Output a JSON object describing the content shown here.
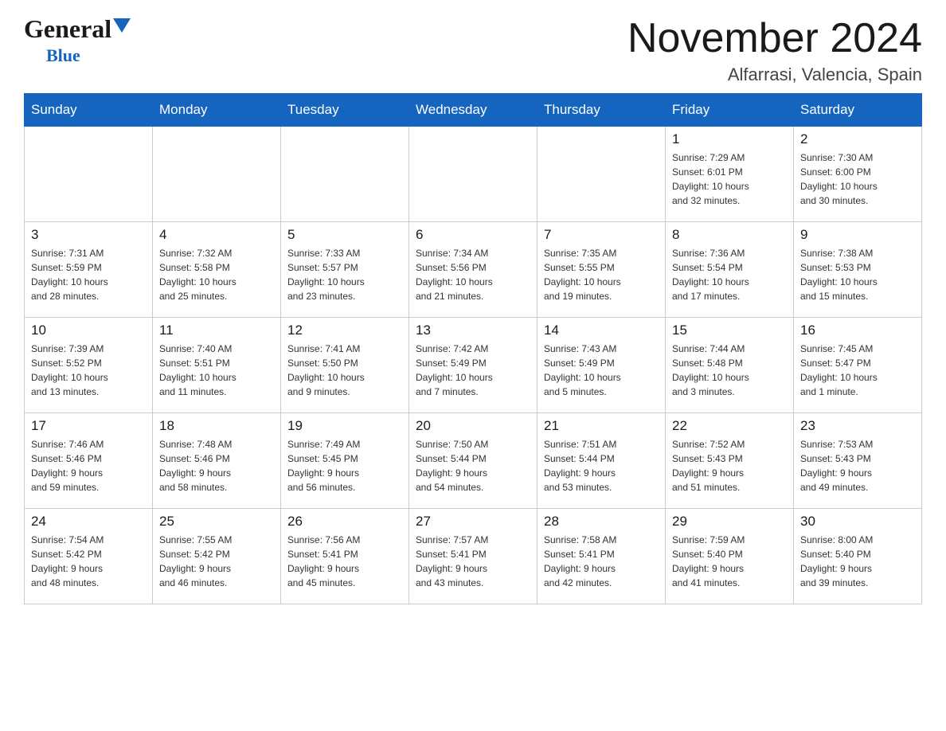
{
  "header": {
    "logo_general": "General",
    "logo_blue": "Blue",
    "month_title": "November 2024",
    "location": "Alfarrasi, Valencia, Spain"
  },
  "days_of_week": [
    "Sunday",
    "Monday",
    "Tuesday",
    "Wednesday",
    "Thursday",
    "Friday",
    "Saturday"
  ],
  "weeks": [
    [
      {
        "day": "",
        "info": ""
      },
      {
        "day": "",
        "info": ""
      },
      {
        "day": "",
        "info": ""
      },
      {
        "day": "",
        "info": ""
      },
      {
        "day": "",
        "info": ""
      },
      {
        "day": "1",
        "info": "Sunrise: 7:29 AM\nSunset: 6:01 PM\nDaylight: 10 hours\nand 32 minutes."
      },
      {
        "day": "2",
        "info": "Sunrise: 7:30 AM\nSunset: 6:00 PM\nDaylight: 10 hours\nand 30 minutes."
      }
    ],
    [
      {
        "day": "3",
        "info": "Sunrise: 7:31 AM\nSunset: 5:59 PM\nDaylight: 10 hours\nand 28 minutes."
      },
      {
        "day": "4",
        "info": "Sunrise: 7:32 AM\nSunset: 5:58 PM\nDaylight: 10 hours\nand 25 minutes."
      },
      {
        "day": "5",
        "info": "Sunrise: 7:33 AM\nSunset: 5:57 PM\nDaylight: 10 hours\nand 23 minutes."
      },
      {
        "day": "6",
        "info": "Sunrise: 7:34 AM\nSunset: 5:56 PM\nDaylight: 10 hours\nand 21 minutes."
      },
      {
        "day": "7",
        "info": "Sunrise: 7:35 AM\nSunset: 5:55 PM\nDaylight: 10 hours\nand 19 minutes."
      },
      {
        "day": "8",
        "info": "Sunrise: 7:36 AM\nSunset: 5:54 PM\nDaylight: 10 hours\nand 17 minutes."
      },
      {
        "day": "9",
        "info": "Sunrise: 7:38 AM\nSunset: 5:53 PM\nDaylight: 10 hours\nand 15 minutes."
      }
    ],
    [
      {
        "day": "10",
        "info": "Sunrise: 7:39 AM\nSunset: 5:52 PM\nDaylight: 10 hours\nand 13 minutes."
      },
      {
        "day": "11",
        "info": "Sunrise: 7:40 AM\nSunset: 5:51 PM\nDaylight: 10 hours\nand 11 minutes."
      },
      {
        "day": "12",
        "info": "Sunrise: 7:41 AM\nSunset: 5:50 PM\nDaylight: 10 hours\nand 9 minutes."
      },
      {
        "day": "13",
        "info": "Sunrise: 7:42 AM\nSunset: 5:49 PM\nDaylight: 10 hours\nand 7 minutes."
      },
      {
        "day": "14",
        "info": "Sunrise: 7:43 AM\nSunset: 5:49 PM\nDaylight: 10 hours\nand 5 minutes."
      },
      {
        "day": "15",
        "info": "Sunrise: 7:44 AM\nSunset: 5:48 PM\nDaylight: 10 hours\nand 3 minutes."
      },
      {
        "day": "16",
        "info": "Sunrise: 7:45 AM\nSunset: 5:47 PM\nDaylight: 10 hours\nand 1 minute."
      }
    ],
    [
      {
        "day": "17",
        "info": "Sunrise: 7:46 AM\nSunset: 5:46 PM\nDaylight: 9 hours\nand 59 minutes."
      },
      {
        "day": "18",
        "info": "Sunrise: 7:48 AM\nSunset: 5:46 PM\nDaylight: 9 hours\nand 58 minutes."
      },
      {
        "day": "19",
        "info": "Sunrise: 7:49 AM\nSunset: 5:45 PM\nDaylight: 9 hours\nand 56 minutes."
      },
      {
        "day": "20",
        "info": "Sunrise: 7:50 AM\nSunset: 5:44 PM\nDaylight: 9 hours\nand 54 minutes."
      },
      {
        "day": "21",
        "info": "Sunrise: 7:51 AM\nSunset: 5:44 PM\nDaylight: 9 hours\nand 53 minutes."
      },
      {
        "day": "22",
        "info": "Sunrise: 7:52 AM\nSunset: 5:43 PM\nDaylight: 9 hours\nand 51 minutes."
      },
      {
        "day": "23",
        "info": "Sunrise: 7:53 AM\nSunset: 5:43 PM\nDaylight: 9 hours\nand 49 minutes."
      }
    ],
    [
      {
        "day": "24",
        "info": "Sunrise: 7:54 AM\nSunset: 5:42 PM\nDaylight: 9 hours\nand 48 minutes."
      },
      {
        "day": "25",
        "info": "Sunrise: 7:55 AM\nSunset: 5:42 PM\nDaylight: 9 hours\nand 46 minutes."
      },
      {
        "day": "26",
        "info": "Sunrise: 7:56 AM\nSunset: 5:41 PM\nDaylight: 9 hours\nand 45 minutes."
      },
      {
        "day": "27",
        "info": "Sunrise: 7:57 AM\nSunset: 5:41 PM\nDaylight: 9 hours\nand 43 minutes."
      },
      {
        "day": "28",
        "info": "Sunrise: 7:58 AM\nSunset: 5:41 PM\nDaylight: 9 hours\nand 42 minutes."
      },
      {
        "day": "29",
        "info": "Sunrise: 7:59 AM\nSunset: 5:40 PM\nDaylight: 9 hours\nand 41 minutes."
      },
      {
        "day": "30",
        "info": "Sunrise: 8:00 AM\nSunset: 5:40 PM\nDaylight: 9 hours\nand 39 minutes."
      }
    ]
  ]
}
